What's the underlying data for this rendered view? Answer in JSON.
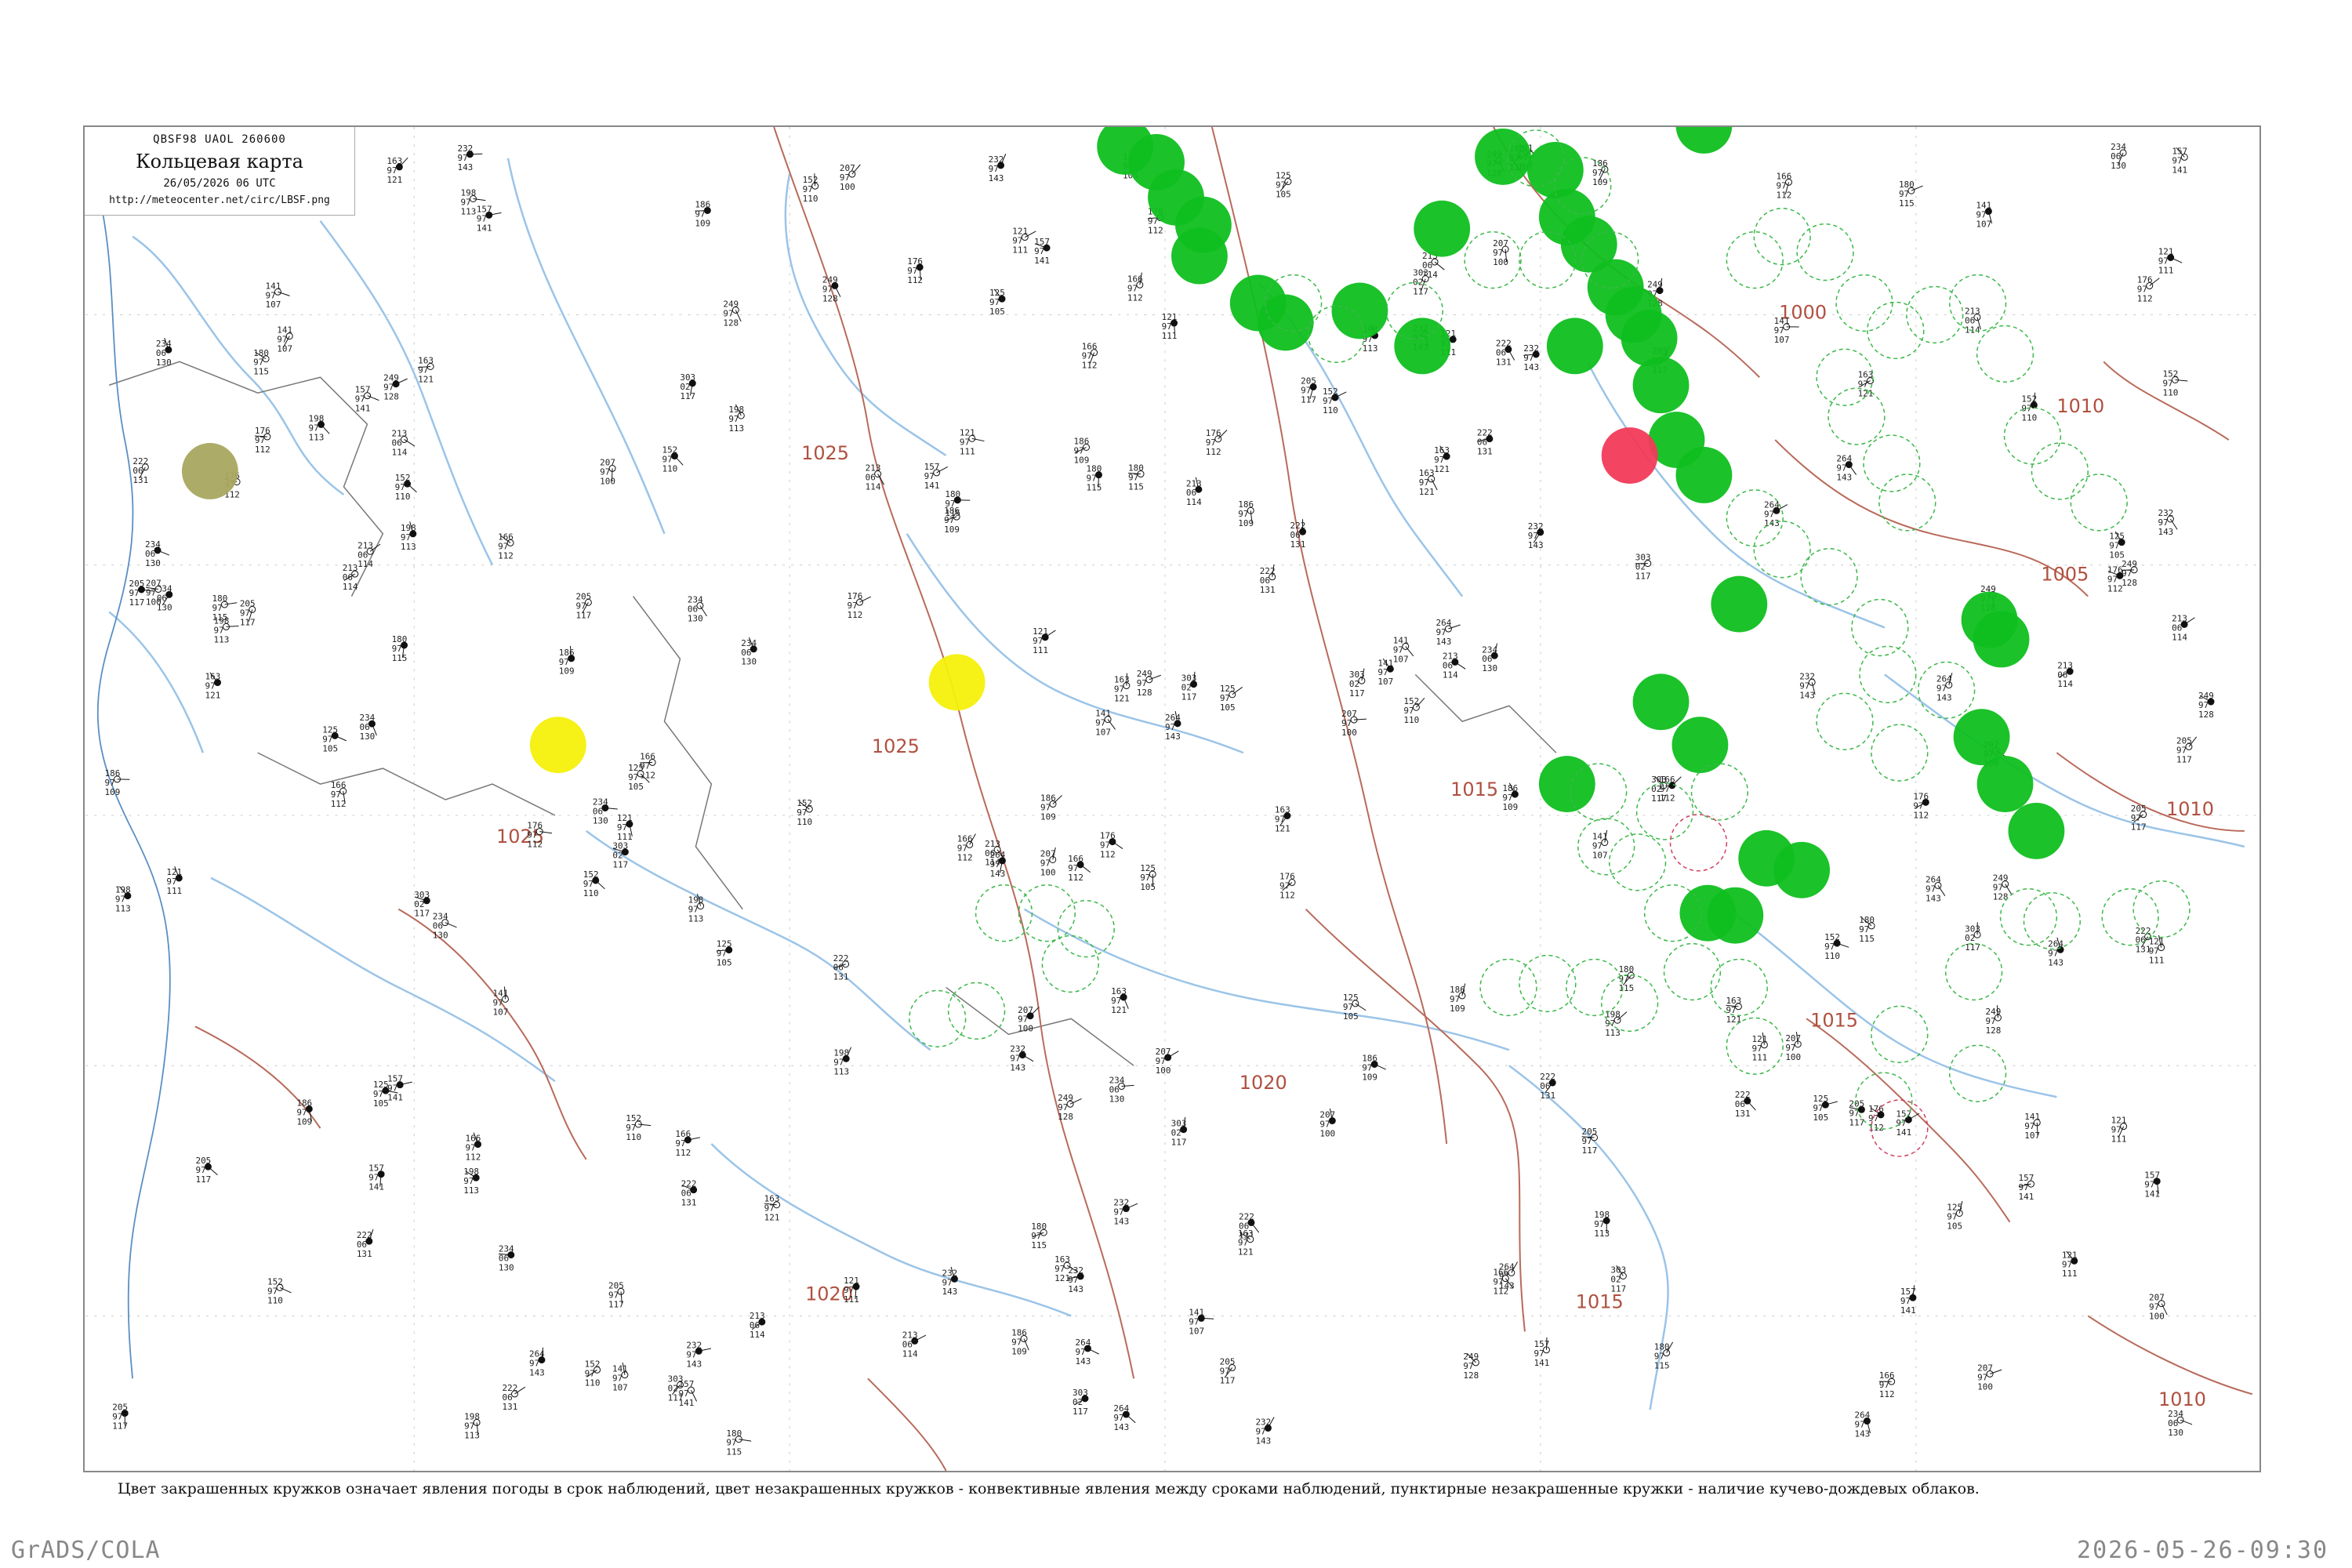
{
  "title_box": {
    "code_line": "QBSF98  UAOL  260600",
    "title": "Кольцевая карта",
    "date": "26/05/2026 06 UTC",
    "url": "http://meteocenter.net/circ/LBSF.png"
  },
  "caption": "Цвет закрашенных кружков означает явления погоды в срок наблюдений, цвет незакрашенных кружков - конвективные явления между сроками наблюдений, пунктирные незакрашенные кружки - наличие кучево-дождевых облаков.",
  "footer": {
    "left": "GrADS/COLA",
    "right": "2026-05-26-09:30"
  },
  "isobar_labels": [
    "1025",
    "1025",
    "1025",
    "1020",
    "1020",
    "1015",
    "1015",
    "1015",
    "1010",
    "1010",
    "1010",
    "1005",
    "1000"
  ],
  "colors": {
    "precip_fill": "#0fbf1f",
    "fog_fill": "#a8a860",
    "thunder_fill": "#f23a5a",
    "haze_fill": "#f5f00a",
    "cb_ring": "#3cb84a",
    "thunder_ring": "#d04060",
    "isobar": "#b86a5a",
    "river": "#9bc4e8",
    "border": "#666666"
  },
  "station_samples": [
    {
      "t": "125",
      "p": "97",
      "td": "105"
    },
    {
      "t": "186",
      "p": "97",
      "td": "109"
    },
    {
      "t": "303",
      "p": "02",
      "td": "117"
    },
    {
      "t": "207",
      "p": "97",
      "td": "100"
    },
    {
      "t": "232",
      "p": "97",
      "td": "143"
    },
    {
      "t": "157",
      "p": "97",
      "td": "141"
    },
    {
      "t": "234",
      "p": "06",
      "td": "130"
    },
    {
      "t": "264",
      "p": "97",
      "td": "143"
    },
    {
      "t": "198",
      "p": "97",
      "td": "113"
    },
    {
      "t": "222",
      "p": "06",
      "td": "131"
    },
    {
      "t": "176",
      "p": "97",
      "td": "112"
    },
    {
      "t": "205",
      "p": "97",
      "td": "117"
    },
    {
      "t": "141",
      "p": "97",
      "td": "107"
    },
    {
      "t": "213",
      "p": "06",
      "td": "114"
    },
    {
      "t": "163",
      "p": "97",
      "td": "121"
    },
    {
      "t": "249",
      "p": "97",
      "td": "128"
    },
    {
      "t": "180",
      "p": "97",
      "td": "115"
    },
    {
      "t": "152",
      "p": "97",
      "td": "110"
    },
    {
      "t": "166",
      "p": "97",
      "td": "112"
    },
    {
      "t": "121",
      "p": "97",
      "td": "111"
    }
  ]
}
